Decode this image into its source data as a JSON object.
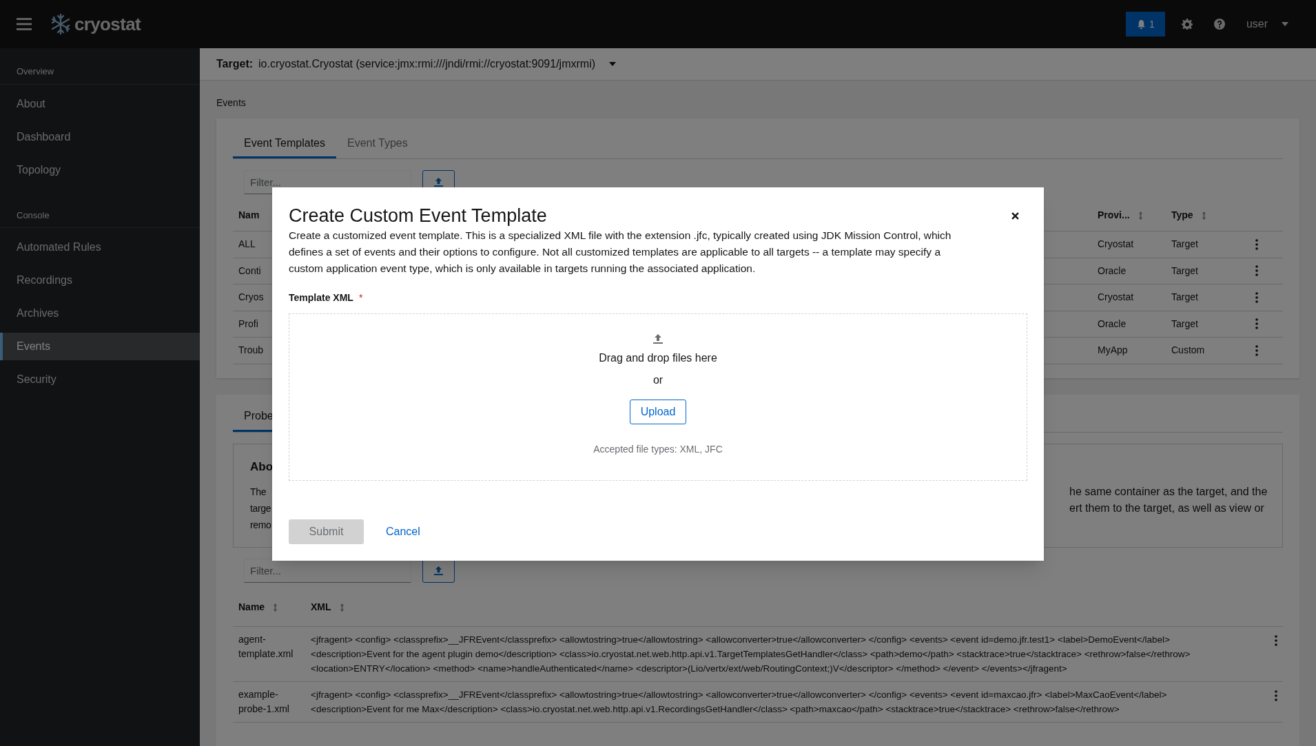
{
  "header": {
    "app_name": "cryostat",
    "notification_count": "1",
    "user": "user"
  },
  "target": {
    "label": "Target:",
    "value": "io.cryostat.Cryostat (service:jmx:rmi:///jndi/rmi://cryostat:9091/jmxrmi)"
  },
  "sidebar": {
    "sections": [
      {
        "title": "Overview",
        "items": [
          {
            "label": "About",
            "selected": false
          },
          {
            "label": "Dashboard",
            "selected": false
          },
          {
            "label": "Topology",
            "selected": false
          }
        ]
      },
      {
        "title": "Console",
        "items": [
          {
            "label": "Automated Rules",
            "selected": false
          },
          {
            "label": "Recordings",
            "selected": false
          },
          {
            "label": "Archives",
            "selected": false
          },
          {
            "label": "Events",
            "selected": true
          },
          {
            "label": "Security",
            "selected": false
          }
        ]
      }
    ]
  },
  "page_title": "Events",
  "templates_card": {
    "tabs": [
      {
        "label": "Event Templates",
        "selected": true
      },
      {
        "label": "Event Types",
        "selected": false
      }
    ],
    "filter": {
      "placeholder": "Filter..."
    },
    "columns": [
      "Nam",
      "Provi...",
      "Type"
    ],
    "rows": [
      {
        "name": "ALL",
        "provider": "Cryostat",
        "type": "Target"
      },
      {
        "name": "Conti",
        "provider": "Oracle",
        "type": "Target"
      },
      {
        "name": "Cryos",
        "provider": "Cryostat",
        "type": "Target"
      },
      {
        "name": "Profi",
        "provider": "Oracle",
        "type": "Target"
      },
      {
        "name": "Troub",
        "provider": "MyApp",
        "type": "Custom"
      }
    ]
  },
  "probes_card": {
    "tabs": [
      {
        "label": "Probe",
        "selected": true
      }
    ],
    "about": {
      "title": "Abo",
      "left_lines": [
        "The",
        "targe",
        "remo"
      ],
      "right_lines": [
        "he same container as the target, and the",
        "ert them to the target, as well as view or"
      ]
    },
    "filter": {
      "placeholder": "Filter..."
    },
    "columns": [
      "Name",
      "XML"
    ],
    "rows": [
      {
        "name": "agent-template.xml",
        "xml_lines": [
          "<jfragent> <config> <classprefix>__JFREvent</classprefix> <allowtostring>true</allowtostring> <allowconverter>true</allowconverter> </config> <events> <event id=demo.jfr.test1> <label>DemoEvent</label>",
          "<description>Event for the agent plugin demo</description> <class>io.cryostat.net.web.http.api.v1.TargetTemplatesGetHandler</class> <path>demo</path> <stacktrace>true</stacktrace> <rethrow>false</rethrow>",
          "<location>ENTRY</location> <method> <name>handleAuthenticated</name> <descriptor>(Lio/vertx/ext/web/RoutingContext;)V</descriptor> </method> </event> </events></jfragent>"
        ]
      },
      {
        "name": "example-probe-1.xml",
        "xml_lines": [
          "<jfragent> <config> <classprefix>__JFREvent</classprefix> <allowtostring>true</allowtostring> <allowconverter>true</allowconverter> </config> <events> <event id=maxcao.jfr> <label>MaxCaoEvent</label>",
          "<description>Event for me Max</description> <class>io.cryostat.net.web.http.api.v1.RecordingsGetHandler</class> <path>maxcao</path> <stacktrace>true</stacktrace> <rethrow>false</rethrow>"
        ]
      }
    ]
  },
  "modal": {
    "title": "Create Custom Event Template",
    "description": "Create a customized event template. This is a specialized XML file with the extension .jfc, typically created using JDK Mission Control, which defines a set of events and their options to configure. Not all customized templates are applicable to all targets -- a template may specify a custom application event type, which is only available in targets running the associated application.",
    "field_label": "Template XML",
    "required_mark": "*",
    "drop_text": "Drag and drop files here",
    "or_text": "or",
    "upload_button": "Upload",
    "accepted_text": "Accepted file types: XML, JFC",
    "submit": {
      "label": "Submit",
      "disabled": true
    },
    "cancel": "Cancel"
  }
}
